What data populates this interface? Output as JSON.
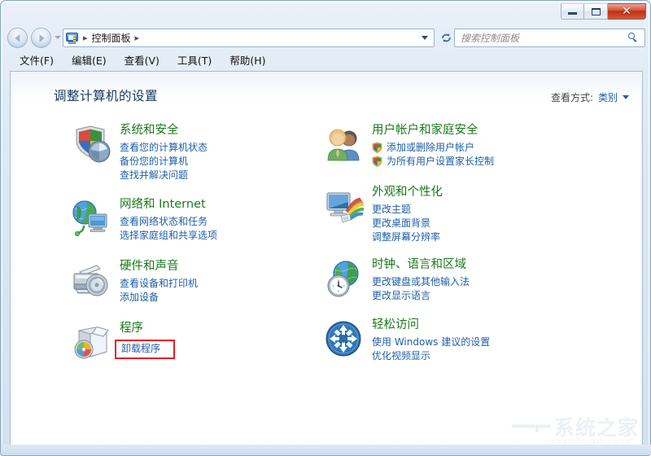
{
  "window": {
    "title": "",
    "caption_buttons": [
      {
        "name": "minimize",
        "label": "—"
      },
      {
        "name": "maximize",
        "label": "□"
      },
      {
        "name": "close",
        "label": "✕"
      }
    ]
  },
  "navbar": {
    "back_label": "◀",
    "forward_label": "▶",
    "address": {
      "icon": "control-panel-icon",
      "crumbs": [
        "控制面板"
      ],
      "separator": "▸"
    },
    "refresh_label": "↻",
    "search": {
      "placeholder": "搜索控制面板",
      "value": ""
    }
  },
  "menubar": {
    "items": [
      {
        "label": "文件(F)"
      },
      {
        "label": "编辑(E)"
      },
      {
        "label": "查看(V)"
      },
      {
        "label": "工具(T)"
      },
      {
        "label": "帮助(H)"
      }
    ]
  },
  "main": {
    "page_title": "调整计算机的设置",
    "view_by": {
      "label": "查看方式:",
      "value": "类别"
    },
    "left_categories": [
      {
        "icon": "security-shield-icon",
        "title": "系统和安全",
        "links": [
          {
            "text": "查看您的计算机状态",
            "shield": false
          },
          {
            "text": "备份您的计算机",
            "shield": false
          },
          {
            "text": "查找并解决问题",
            "shield": false
          }
        ]
      },
      {
        "icon": "network-globe-icon",
        "title": "网络和 Internet",
        "links": [
          {
            "text": "查看网络状态和任务",
            "shield": false
          },
          {
            "text": "选择家庭组和共享选项",
            "shield": false
          }
        ]
      },
      {
        "icon": "printer-hardware-icon",
        "title": "硬件和声音",
        "links": [
          {
            "text": "查看设备和打印机",
            "shield": false
          },
          {
            "text": "添加设备",
            "shield": false
          }
        ]
      },
      {
        "icon": "programs-box-icon",
        "title": "程序",
        "links": [
          {
            "text": "卸载程序",
            "shield": false,
            "highlighted": true
          }
        ]
      }
    ],
    "right_categories": [
      {
        "icon": "user-accounts-icon",
        "title": "用户帐户和家庭安全",
        "links": [
          {
            "text": "添加或删除用户帐户",
            "shield": true
          },
          {
            "text": "为所有用户设置家长控制",
            "shield": true
          }
        ]
      },
      {
        "icon": "appearance-monitor-icon",
        "title": "外观和个性化",
        "links": [
          {
            "text": "更改主题",
            "shield": false
          },
          {
            "text": "更改桌面背景",
            "shield": false
          },
          {
            "text": "调整屏幕分辨率",
            "shield": false
          }
        ]
      },
      {
        "icon": "clock-globe-icon",
        "title": "时钟、语言和区域",
        "links": [
          {
            "text": "更改键盘或其他输入法",
            "shield": false
          },
          {
            "text": "更改显示语言",
            "shield": false
          }
        ]
      },
      {
        "icon": "ease-of-access-icon",
        "title": "轻松访问",
        "links": [
          {
            "text": "使用 Windows 建议的设置",
            "shield": false
          },
          {
            "text": "优化视频显示",
            "shield": false
          }
        ]
      }
    ]
  },
  "watermark": {
    "mark": "一⌐",
    "text": "系统之家",
    "sub": "www.xitongzhijia.net"
  },
  "colors": {
    "category_title": "#1a7a1a",
    "link": "#1f5fa9",
    "page_title": "#17365d",
    "highlight_border": "#ee1c22",
    "close_button": "#bf2f13"
  }
}
